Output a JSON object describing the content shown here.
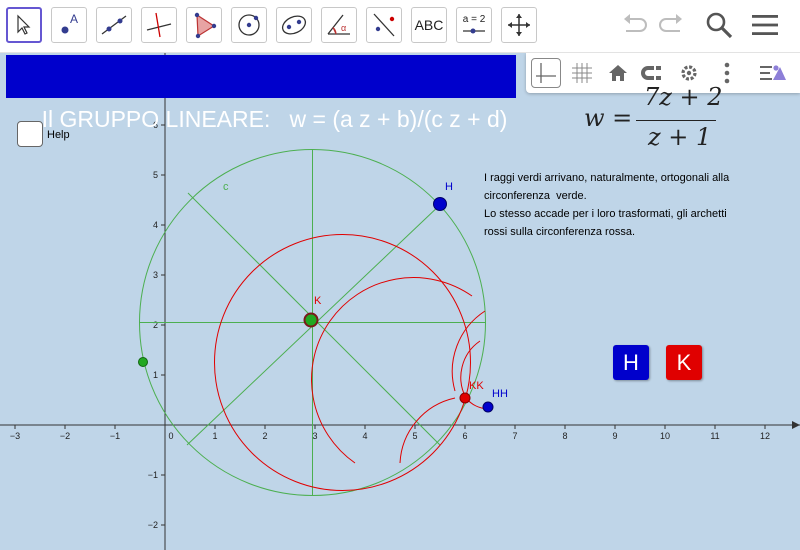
{
  "toolbar": {
    "tools": [
      {
        "name": "move-tool-button"
      },
      {
        "name": "point-tool-button",
        "label": "A"
      },
      {
        "name": "line-tool-button"
      },
      {
        "name": "perpendicular-tool-button"
      },
      {
        "name": "polygon-tool-button"
      },
      {
        "name": "circle-center-point-tool-button"
      },
      {
        "name": "ellipse-tool-button"
      },
      {
        "name": "angle-tool-button",
        "label": "α"
      },
      {
        "name": "reflect-tool-button"
      },
      {
        "name": "text-tool-button",
        "label": "ABC"
      },
      {
        "name": "slider-tool-button",
        "label": "a = 2"
      },
      {
        "name": "move-graphics-view-tool-button"
      }
    ],
    "right_icons": [
      "undo-icon",
      "redo-icon",
      "search-icon",
      "menu-icon"
    ]
  },
  "style_bar_icons": [
    "axes-icon",
    "grid-icon",
    "home-icon",
    "point-capturing-icon",
    "settings-icon",
    "more-icon",
    "toggle-style-bar-icon"
  ],
  "title": "Il GRUPPO LINEARE:   w = (a z + b)/(c z + d)",
  "help_label": "Help",
  "formula": {
    "lhs": "w =",
    "numerator": "7z + 2",
    "denominator": "z + 1"
  },
  "comment_lines": [
    "I raggi verdi arrivano, naturalmente, ortogonali alla",
    "circonferenza  verde.",
    "Lo stesso accade per i loro trasformati, gli archetti",
    "rossi sulla circonferenza rossa."
  ],
  "buttons": {
    "h": "H",
    "k": "K"
  },
  "axes": {
    "x_ticks": [
      "−3",
      "−2",
      "−1",
      "0",
      "1",
      "2",
      "3",
      "4",
      "5",
      "6",
      "7",
      "8",
      "9",
      "10",
      "11",
      "12"
    ],
    "y_ticks": [
      "−2",
      "−1",
      "1",
      "2",
      "3",
      "4",
      "5",
      "6"
    ]
  },
  "labels": {
    "c": "c",
    "H": "H",
    "K": "K",
    "KK": "KK",
    "HH": "HH"
  },
  "colors": {
    "background": "#bfd5e8",
    "title_bg": "#0000cc",
    "green": "#4caf50",
    "red": "#e00000",
    "blue": "#0000cc"
  }
}
